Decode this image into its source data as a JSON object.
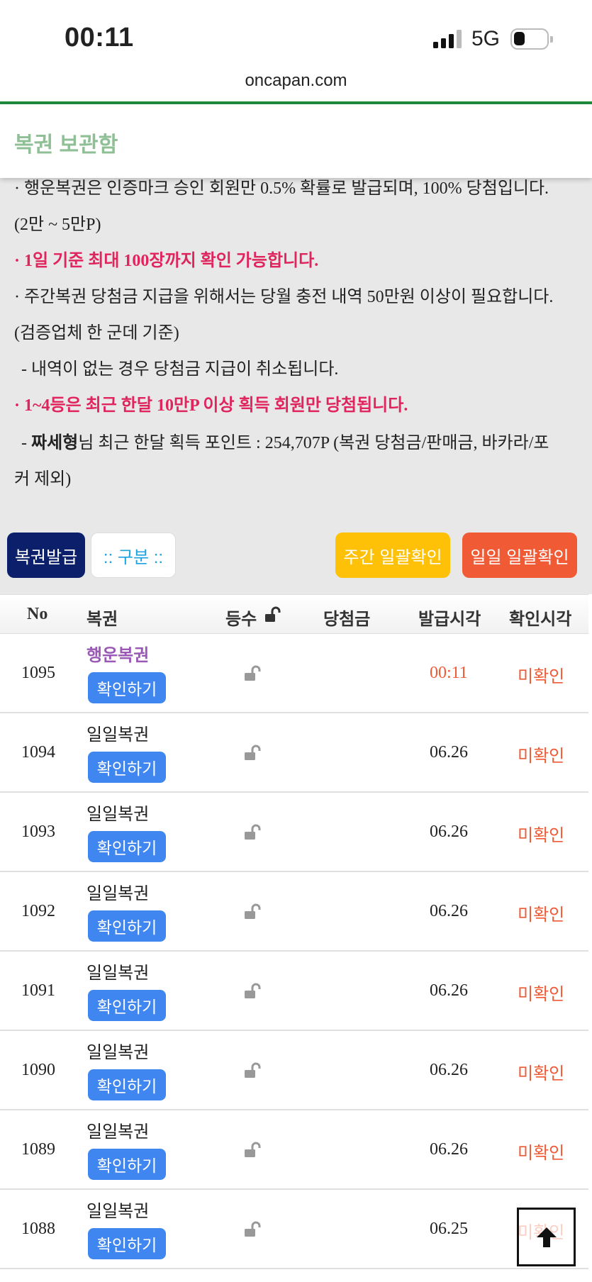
{
  "status_bar": {
    "time": "00:11",
    "network": "5G"
  },
  "browser": {
    "url": "oncapan.com"
  },
  "page": {
    "title": "복권 보관함"
  },
  "notice": {
    "line1": "· 행운복권은 인증마크 승인 회원만 0.5% 확률로 발급되며, 100% 당첨입니다.",
    "line2": "(2만 ~ 5만P)",
    "line3": "· 1일 기준 최대 100장까지 확인 가능합니다.",
    "line4": "· 주간복권 당첨금 지급을 위해서는 당월 충전 내역 50만원 이상이 필요합니다.",
    "line5": "(검증업체 한 군데 기준)",
    "line6": "- 내역이 없는 경우 당첨금 지급이 취소됩니다.",
    "line7": "· 1~4등은 최근 한달 10만P 이상 획득 회원만 당첨됩니다.",
    "line8_prefix": "- ",
    "line8_user": "짜세형",
    "line8_rest": "님 최근 한달 획득 포인트 : 254,707P (복권 당첨금/판매금, 바카라/포",
    "line9": "커 제외)"
  },
  "buttons": {
    "issue": "복권발급",
    "type": ":: 구분 ::",
    "weekly_confirm": "주간 일괄확인",
    "daily_confirm": "일일 일괄확인"
  },
  "table": {
    "headers": {
      "no": "No",
      "name": "복권",
      "rank": "등수",
      "prize": "당첨금",
      "issued": "발급시각",
      "checked": "확인시각"
    },
    "check_label": "확인하기",
    "rows": [
      {
        "no": "1095",
        "name": "행운복권",
        "issued": "00:11",
        "status": "미확인"
      },
      {
        "no": "1094",
        "name": "일일복권",
        "issued": "06.26",
        "status": "미확인"
      },
      {
        "no": "1093",
        "name": "일일복권",
        "issued": "06.26",
        "status": "미확인"
      },
      {
        "no": "1092",
        "name": "일일복권",
        "issued": "06.26",
        "status": "미확인"
      },
      {
        "no": "1091",
        "name": "일일복권",
        "issued": "06.26",
        "status": "미확인"
      },
      {
        "no": "1090",
        "name": "일일복권",
        "issued": "06.26",
        "status": "미확인"
      },
      {
        "no": "1089",
        "name": "일일복권",
        "issued": "06.26",
        "status": "미확인"
      },
      {
        "no": "1088",
        "name": "일일복권",
        "issued": "06.25",
        "status": "미확인"
      }
    ]
  },
  "colors": {
    "accent_green": "#1e8a3c",
    "title_green": "#8fbf95",
    "orange": "#f05a35",
    "red_notice": "#e0245e",
    "blue_button": "#3f86f0",
    "navy": "#0b1f6b",
    "yellow": "#ffc107"
  },
  "icons": {
    "lock": "unlock-icon",
    "scroll_top": "arrow-up-icon"
  }
}
